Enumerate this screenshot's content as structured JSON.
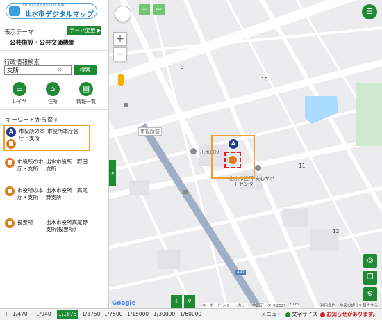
{
  "header": {
    "logo_small": "IZUMI CITY DIGITAL MAP",
    "logo_city": "出水市",
    "logo_main": "デジタルマップ"
  },
  "sidebar": {
    "theme_label": "表示テーマ",
    "theme_button": "テーマ変更 ▶",
    "theme_value": "公共施設・公共交通機関",
    "admin_label": "行政情報検索",
    "search": {
      "value": "支所",
      "placeholder": ""
    },
    "search_button": "検索",
    "tools": [
      {
        "label": "レイヤ",
        "icon": "list-icon"
      },
      {
        "label": "住所",
        "icon": "home-icon"
      },
      {
        "label": "情報一覧",
        "icon": "table-icon"
      }
    ],
    "keyword_label": "キーワードから探す",
    "results": [
      {
        "name": "市役所の本庁・支所",
        "address": "市役所本庁舎",
        "selected": true
      },
      {
        "name": "市役所の本庁・支所",
        "address": "出水市役所　野田支所",
        "selected": false
      },
      {
        "name": "市役所の本庁・支所",
        "address": "出水市役所　高尾野支所",
        "selected": false
      },
      {
        "name": "投票所",
        "address": "出水市役所高尾野支所(投票所)",
        "selected": false
      }
    ]
  },
  "map": {
    "zoom_in": "+",
    "zoom_out": "−",
    "labels": {
      "station": "市役所前",
      "city_hall": "出水市役",
      "support_center": "出水市役所 安心サポートセンター",
      "route": "447"
    },
    "block_numbers": [
      "9",
      "10",
      "11",
      "12"
    ],
    "google": "Google",
    "attribution": {
      "shortcuts": "キーボード ショートカット",
      "mapdata": "地図データ ©2025",
      "scale": "20 m",
      "terms": "利用規約",
      "report": "地図の誤りを報告する"
    }
  },
  "bottombar": {
    "prefix": "+",
    "scales": [
      "1/470",
      "1/940",
      "1/1875",
      "1/3750",
      "1/7500",
      "1/15000",
      "1/30000",
      "1/60000",
      "−"
    ],
    "active_scale": "1/1875",
    "menu": "メニュー",
    "text_size": "文字サイズ",
    "notice": "お知らせがあります。"
  },
  "colors": {
    "accent": "#1f8a34",
    "highlight": "#f0a030",
    "marker": "#e07b1a"
  }
}
